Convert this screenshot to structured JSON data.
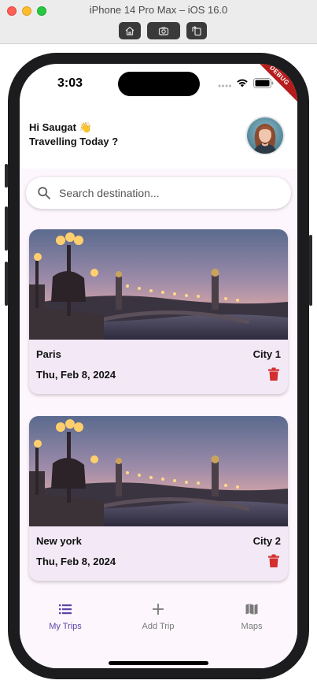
{
  "window": {
    "title": "iPhone 14 Pro Max – iOS 16.0",
    "toolbar_icons": [
      "home-icon",
      "screenshot-icon",
      "rotate-icon"
    ]
  },
  "status_bar": {
    "time": "3:03",
    "debug_banner": "DEBUG"
  },
  "header": {
    "greeting": "Hi Saugat 👋",
    "subtitle": "Travelling Today ?"
  },
  "search": {
    "placeholder": "Search destination..."
  },
  "trips": [
    {
      "name": "Paris",
      "city_label": "City 1",
      "date": "Thu, Feb 8, 2024"
    },
    {
      "name": "New york",
      "city_label": "City 2",
      "date": "Thu, Feb 8, 2024"
    }
  ],
  "bottom_nav": {
    "items": [
      {
        "label": "My Trips",
        "icon": "list-icon",
        "active": true
      },
      {
        "label": "Add Trip",
        "icon": "plus-icon",
        "active": false
      },
      {
        "label": "Maps",
        "icon": "map-icon",
        "active": false
      }
    ]
  },
  "colors": {
    "accent": "#5a45a8",
    "delete": "#d32f2f",
    "card_bg": "#f3e9f6",
    "page_bg": "#fdf7fd"
  }
}
